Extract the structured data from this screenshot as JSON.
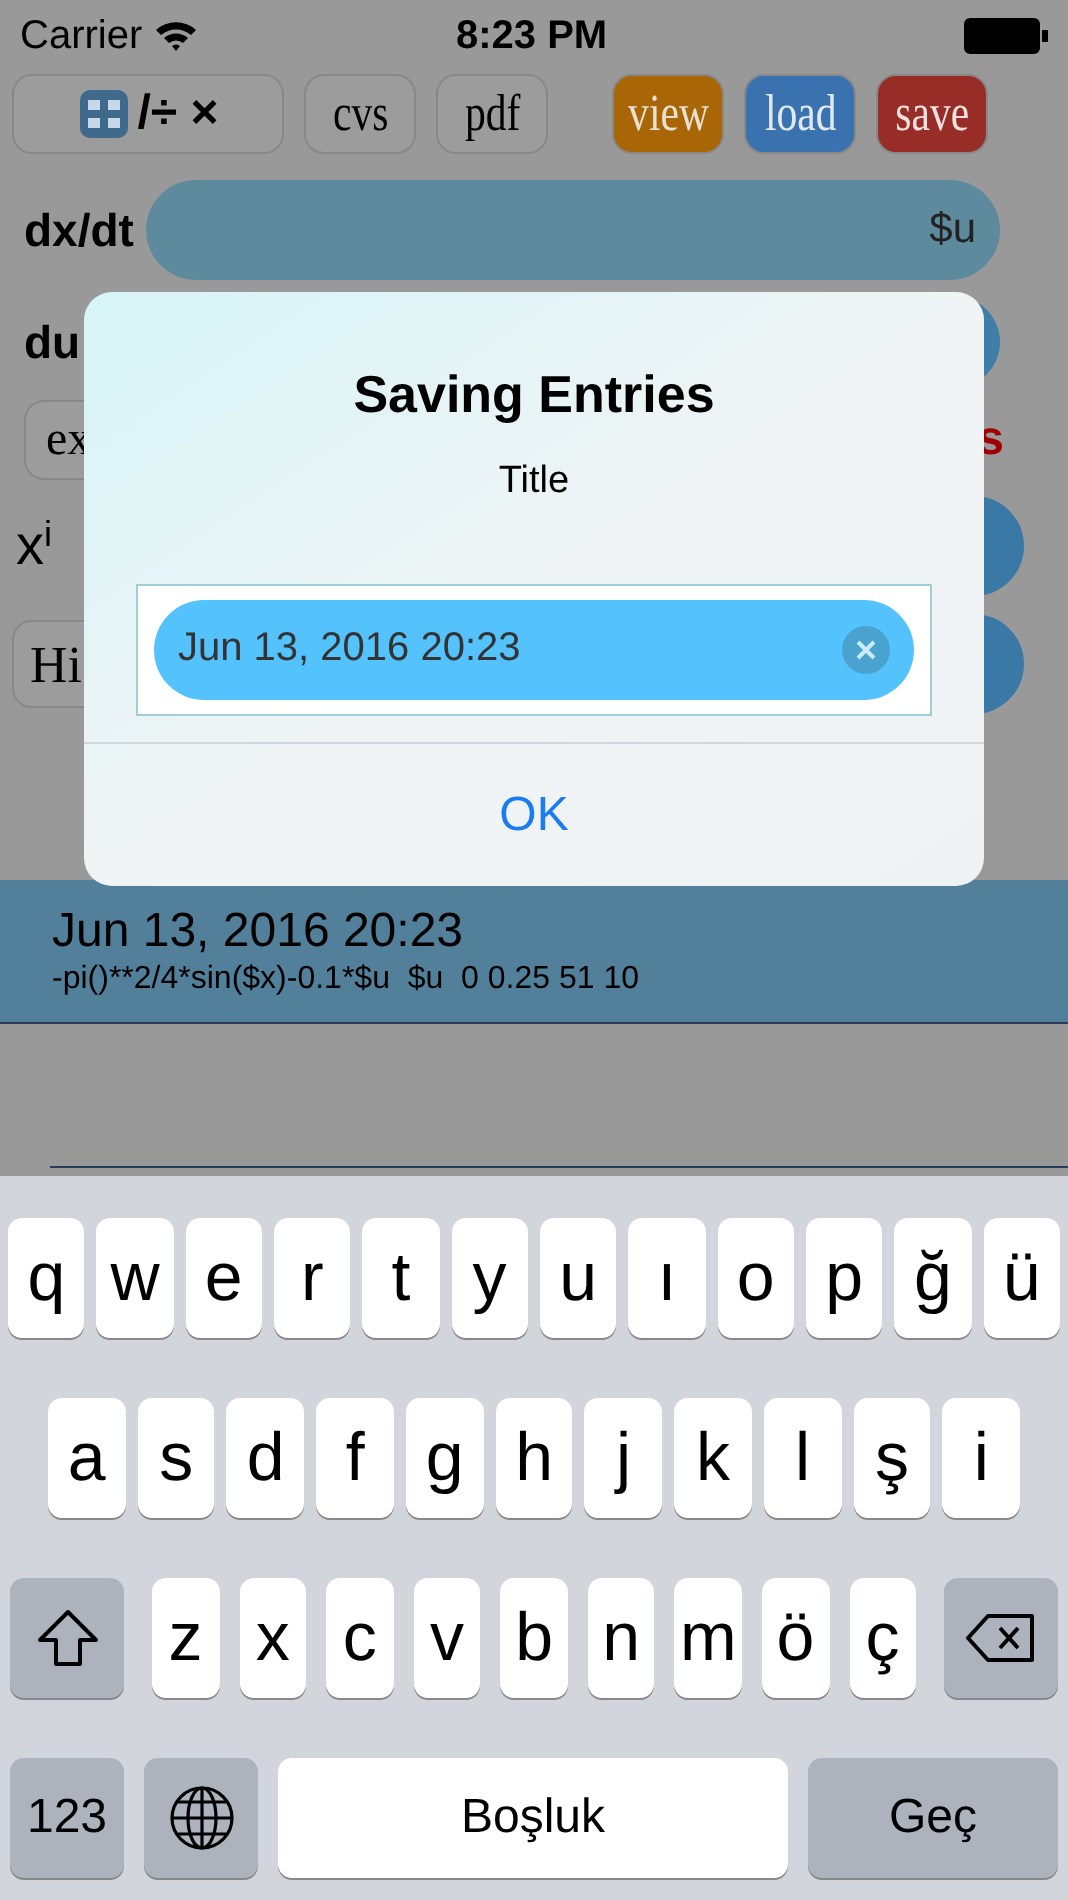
{
  "status_bar": {
    "carrier": "Carrier",
    "time": "8:23 PM"
  },
  "toolbar": [
    {
      "kind": "ops",
      "label": "/÷ ×"
    },
    {
      "kind": "plain",
      "label": "cvs"
    },
    {
      "kind": "plain",
      "label": "pdf"
    },
    {
      "kind": "view",
      "label": "view"
    },
    {
      "kind": "load",
      "label": "load"
    },
    {
      "kind": "save",
      "label": "save"
    }
  ],
  "form": {
    "dx_label": "dx/dt",
    "dx_value": "$u",
    "du_label": "du",
    "ex_button": "ex",
    "red_text": "s",
    "xi_base": "x",
    "xi_sup": "i",
    "hide_button": "Hi"
  },
  "entries": [
    {
      "title": "Jun 13, 2016 20:23",
      "detail": "-pi()**2/4*sin($x)-0.1*$u  $u  0 0.25 51 10",
      "selected": true
    }
  ],
  "dialog": {
    "title": "Saving Entries",
    "message": "Title",
    "field_value": "Jun 13, 2016 20:23",
    "button": "OK"
  },
  "keyboard": [
    [
      {
        "kind": "letter",
        "label": "q"
      },
      {
        "kind": "letter",
        "label": "w"
      },
      {
        "kind": "letter",
        "label": "e"
      },
      {
        "kind": "letter",
        "label": "r"
      },
      {
        "kind": "letter",
        "label": "t"
      },
      {
        "kind": "letter",
        "label": "y"
      },
      {
        "kind": "letter",
        "label": "u"
      },
      {
        "kind": "letter",
        "label": "ı"
      },
      {
        "kind": "letter",
        "label": "o"
      },
      {
        "kind": "letter",
        "label": "p"
      },
      {
        "kind": "letter",
        "label": "ğ"
      },
      {
        "kind": "letter",
        "label": "ü"
      }
    ],
    [
      {
        "kind": "letter",
        "label": "a"
      },
      {
        "kind": "letter",
        "label": "s"
      },
      {
        "kind": "letter",
        "label": "d"
      },
      {
        "kind": "letter",
        "label": "f"
      },
      {
        "kind": "letter",
        "label": "g"
      },
      {
        "kind": "letter",
        "label": "h"
      },
      {
        "kind": "letter",
        "label": "j"
      },
      {
        "kind": "letter",
        "label": "k"
      },
      {
        "kind": "letter",
        "label": "l"
      },
      {
        "kind": "letter",
        "label": "ş"
      },
      {
        "kind": "letter",
        "label": "i"
      }
    ],
    [
      {
        "kind": "shift"
      },
      {
        "kind": "letter",
        "label": "z"
      },
      {
        "kind": "letter",
        "label": "x"
      },
      {
        "kind": "letter",
        "label": "c"
      },
      {
        "kind": "letter",
        "label": "v"
      },
      {
        "kind": "letter",
        "label": "b"
      },
      {
        "kind": "letter",
        "label": "n"
      },
      {
        "kind": "letter",
        "label": "m"
      },
      {
        "kind": "letter",
        "label": "ö"
      },
      {
        "kind": "letter",
        "label": "ç"
      },
      {
        "kind": "backspace"
      }
    ],
    [
      {
        "kind": "numbers",
        "label": "123"
      },
      {
        "kind": "globe"
      },
      {
        "kind": "space",
        "label": "Boşluk"
      },
      {
        "kind": "return",
        "label": "Geç"
      }
    ]
  ]
}
